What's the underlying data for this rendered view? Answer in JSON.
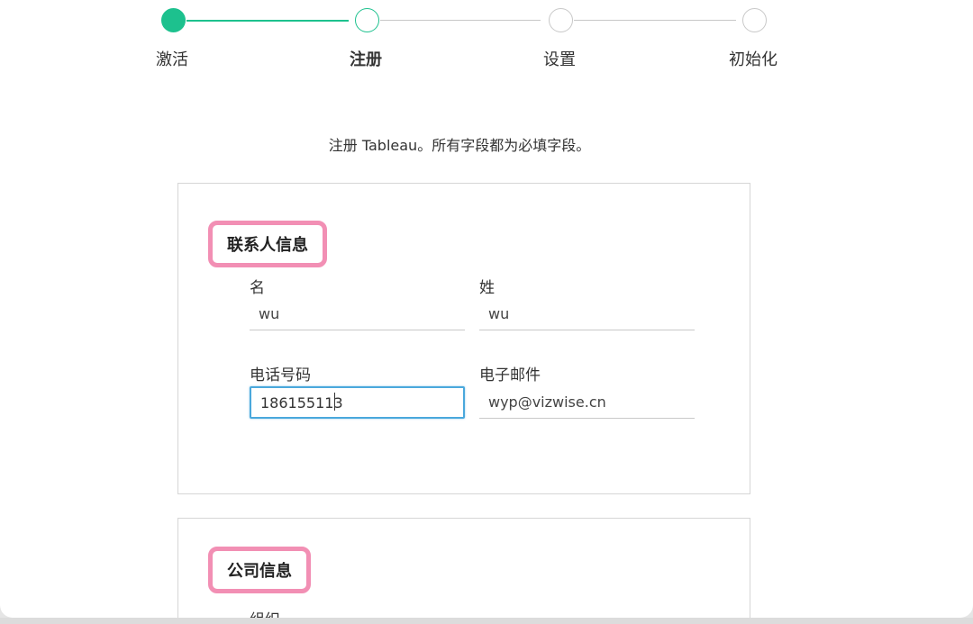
{
  "stepper": {
    "steps": [
      {
        "label": "激活",
        "state": "done"
      },
      {
        "label": "注册",
        "state": "current"
      },
      {
        "label": "设置",
        "state": "pending"
      },
      {
        "label": "初始化",
        "state": "pending"
      }
    ]
  },
  "intro_text": "注册 Tableau。所有字段都为必填字段。",
  "contact": {
    "title": "联系人信息",
    "first_name_label": "名",
    "first_name_value": "wu",
    "last_name_label": "姓",
    "last_name_value": "wu",
    "phone_label": "电话号码",
    "phone_value": "186155113",
    "email_label": "电子邮件",
    "email_value": "wyp@vizwise.cn"
  },
  "company": {
    "title": "公司信息",
    "org_label": "组织"
  },
  "colors": {
    "accent": "#1dc18e",
    "highlight": "#f28fb4",
    "focus": "#4aa8dc"
  }
}
